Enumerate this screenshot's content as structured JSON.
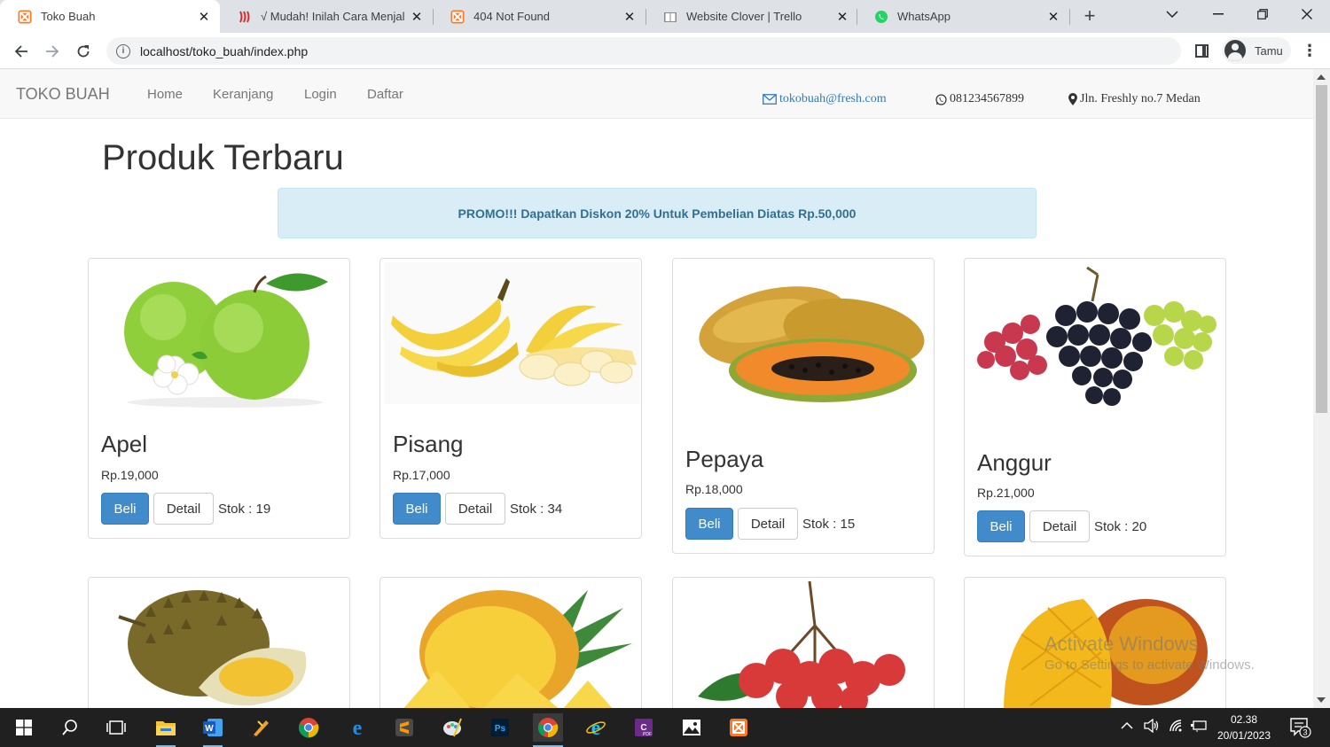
{
  "browser": {
    "tabs": [
      {
        "title": "Toko Buah",
        "active": true,
        "icon": "xampp-icon"
      },
      {
        "title": "√ Mudah! Inilah Cara Menjala",
        "active": false,
        "icon": "signal-icon"
      },
      {
        "title": "404 Not Found",
        "active": false,
        "icon": "xampp-icon"
      },
      {
        "title": "Website Clover | Trello",
        "active": false,
        "icon": "book-icon"
      },
      {
        "title": "WhatsApp",
        "active": false,
        "icon": "whatsapp-icon"
      }
    ],
    "url": "localhost/toko_buah/index.php",
    "profile_name": "Tamu"
  },
  "navbar": {
    "brand": "TOKO BUAH",
    "links": [
      "Home",
      "Keranjang",
      "Login",
      "Daftar"
    ],
    "email": "tokobuah@fresh.com",
    "phone": "081234567899",
    "address": "Jln. Freshly no.7 Medan"
  },
  "main": {
    "title": "Produk Terbaru",
    "promo": "PROMO!!! Dapatkan Diskon 20% Untuk Pembelian Diatas Rp.50,000",
    "buy_label": "Beli",
    "detail_label": "Detail",
    "products": [
      {
        "name": "Apel",
        "price": "Rp.19,000",
        "stock": "Stok : 19"
      },
      {
        "name": "Pisang",
        "price": "Rp.17,000",
        "stock": "Stok : 34"
      },
      {
        "name": "Pepaya",
        "price": "Rp.18,000",
        "stock": "Stok : 15"
      },
      {
        "name": "Anggur",
        "price": "Rp.21,000",
        "stock": "Stok : 20"
      }
    ]
  },
  "watermark": {
    "line1": "Activate Windows",
    "line2": "Go to Settings to activate Windows."
  },
  "taskbar": {
    "time": "02.38",
    "date": "20/01/2023",
    "notifications": "3"
  }
}
